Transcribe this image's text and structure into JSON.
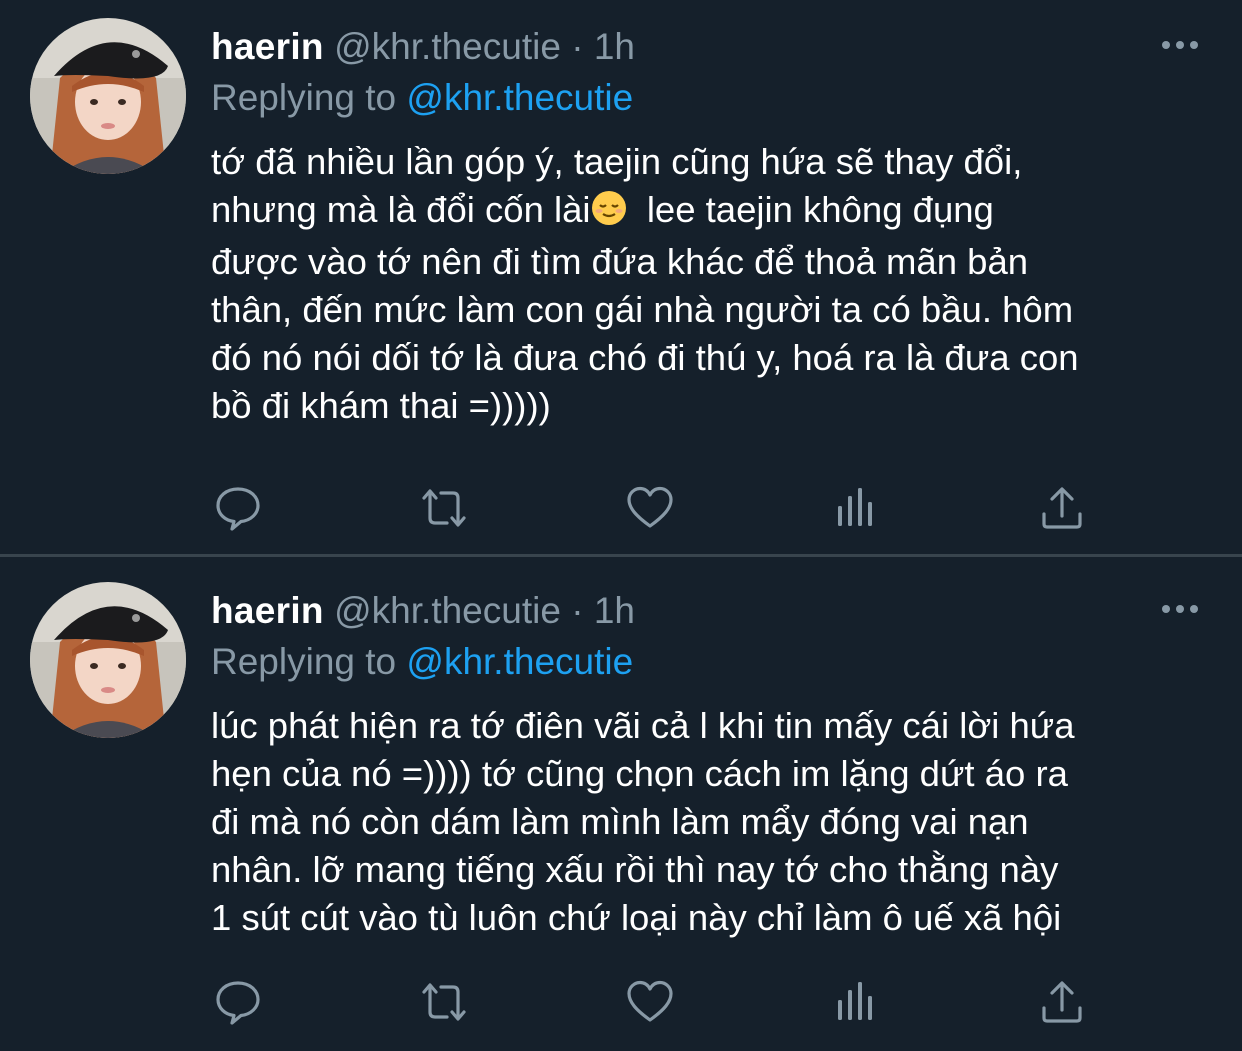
{
  "tweets": [
    {
      "name": "haerin",
      "handle": "@khr.thecutie",
      "separator": "·",
      "time": "1h",
      "replying_prefix": "Replying to",
      "replying_to": "@khr.thecutie",
      "lines": [
        "tớ đã nhiều lần góp ý, taejin cũng hứa sẽ thay đổi,",
        "nhưng mà là đổi cốn lài",
        "được vào tớ nên đi tìm đứa khác để thoả mãn bản",
        "thân, đến mức làm con gái nhà người ta có bầu. hôm",
        "đó nó nói dối tớ là đưa chó đi thú y, hoá ra là đưa con",
        "bồ đi khám thai =)))))"
      ],
      "line2_tail": "  lee taejin không đụng",
      "emoji": "relieved-face-emoji"
    },
    {
      "name": "haerin",
      "handle": "@khr.thecutie",
      "separator": "·",
      "time": "1h",
      "replying_prefix": "Replying to",
      "replying_to": "@khr.thecutie",
      "lines": [
        "lúc phát hiện ra tớ điên vãi cả l khi tin mấy cái lời hứa",
        "hẹn của nó =)))) tớ cũng chọn cách im lặng dứt áo ra",
        "đi mà nó còn dám làm mình làm mẩy đóng vai nạn",
        "nhân. lỡ mang tiếng xấu rồi thì nay tớ cho thằng này",
        "1 sút cút vào tù luôn chứ loại này chỉ làm ô uế xã hội"
      ]
    }
  ],
  "icons": {
    "reply": "speech-bubble-icon",
    "retweet": "retweet-icon",
    "like": "heart-icon",
    "analytics": "bar-chart-icon",
    "share": "share-upload-icon",
    "more": "more-dots-icon"
  },
  "colors": {
    "background": "#15202b",
    "text": "#ffffff",
    "secondary": "#8899a6",
    "link": "#1da1f2",
    "divider": "#38444d"
  }
}
